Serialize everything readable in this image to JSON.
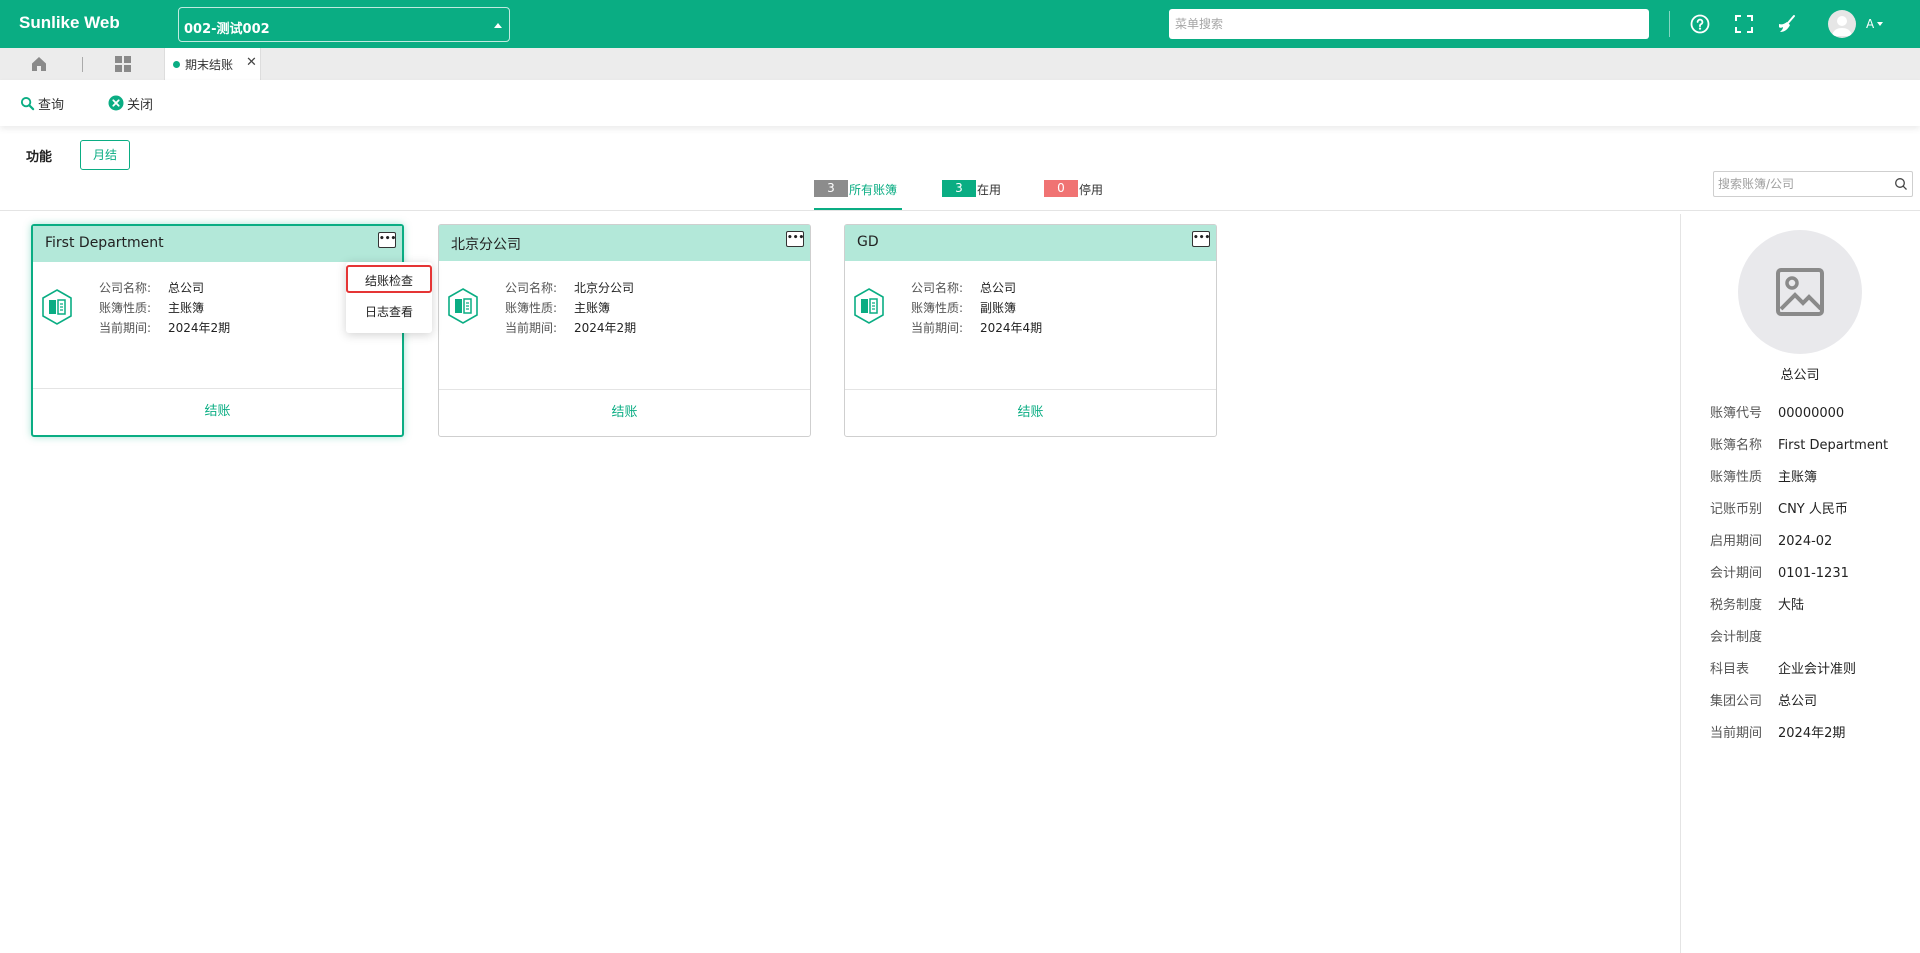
{
  "app": {
    "brand": "Sunlike Web",
    "account_selector": "002-测试002",
    "menu_search_placeholder": "菜单搜索",
    "user_initial": "A"
  },
  "tabs": [
    {
      "label": "期末结账",
      "active": true
    }
  ],
  "toolbar": {
    "query_label": "查询",
    "close_label": "关闭"
  },
  "function_bar": {
    "label": "功能",
    "month_close_button": "月结"
  },
  "filters": [
    {
      "count": "3",
      "label": "所有账簿",
      "color": "#8c8c8c",
      "active": true
    },
    {
      "count": "3",
      "label": "在用",
      "color": "#0aad83",
      "active": false
    },
    {
      "count": "0",
      "label": "停用",
      "color": "#f07373",
      "active": false
    }
  ],
  "book_search_placeholder": "搜索账簿/公司",
  "cards": [
    {
      "title": "First Department",
      "selected": true,
      "fields": [
        {
          "label": "公司名称:",
          "value": "总公司"
        },
        {
          "label": "账簿性质:",
          "value": "主账簿"
        },
        {
          "label": "当前期间:",
          "value": "2024年2期"
        }
      ],
      "action": "结账"
    },
    {
      "title": "北京分公司",
      "selected": false,
      "fields": [
        {
          "label": "公司名称:",
          "value": "北京分公司"
        },
        {
          "label": "账簿性质:",
          "value": "主账簿"
        },
        {
          "label": "当前期间:",
          "value": "2024年2期"
        }
      ],
      "action": "结账"
    },
    {
      "title": "GD",
      "selected": false,
      "fields": [
        {
          "label": "公司名称:",
          "value": "总公司"
        },
        {
          "label": "账簿性质:",
          "value": "副账簿"
        },
        {
          "label": "当前期间:",
          "value": "2024年4期"
        }
      ],
      "action": "结账"
    }
  ],
  "dropdown_menu": {
    "items": [
      "结账检查",
      "日志查看"
    ],
    "highlighted_index": 0
  },
  "detail_panel": {
    "company": "总公司",
    "rows": [
      {
        "label": "账簿代号",
        "value": "00000000"
      },
      {
        "label": "账簿名称",
        "value": "First Department"
      },
      {
        "label": "账簿性质",
        "value": "主账簿"
      },
      {
        "label": "记账币别",
        "value": "CNY 人民币"
      },
      {
        "label": "启用期间",
        "value": "2024-02"
      },
      {
        "label": "会计期间",
        "value": "0101-1231"
      },
      {
        "label": "税务制度",
        "value": "大陆"
      },
      {
        "label": "会计制度",
        "value": ""
      },
      {
        "label": "科目表",
        "value": "企业会计准则"
      },
      {
        "label": "集团公司",
        "value": "总公司"
      },
      {
        "label": "当前期间",
        "value": "2024年2期"
      }
    ]
  },
  "colors": {
    "brand": "#0aad83",
    "card_header": "#b3e8d9",
    "highlight_border": "#e53535"
  }
}
